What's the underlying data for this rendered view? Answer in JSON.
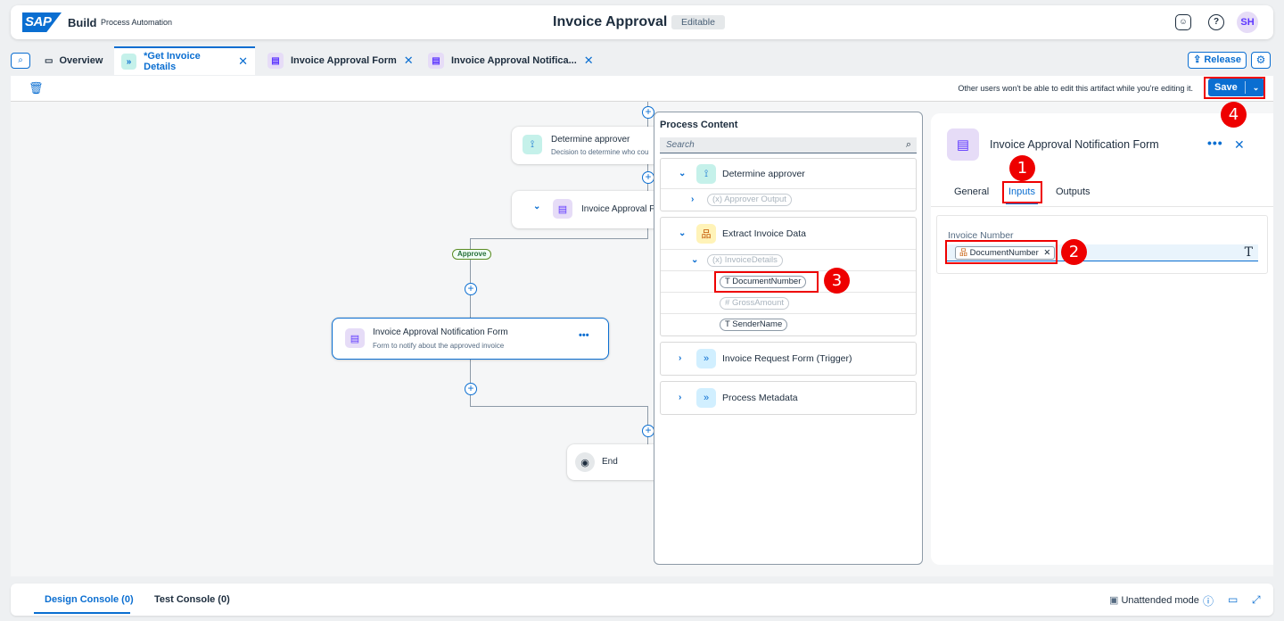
{
  "shell": {
    "logo": "SAP",
    "product": "Build",
    "subtitle": "Process Automation",
    "title": "Invoice Approval",
    "status_badge": "Editable",
    "avatar_initials": "SH"
  },
  "tabs": [
    {
      "label": "Overview"
    },
    {
      "label": "*Get Invoice Details"
    },
    {
      "label": "Invoice Approval Form"
    },
    {
      "label": "Invoice Approval Notifica..."
    }
  ],
  "actions": {
    "release": "Release",
    "save": "Save",
    "lock_note": "Other users won't be able to edit this artifact while you're editing it."
  },
  "canvas": {
    "determine_title": "Determine approver",
    "determine_sub": "Decision to determine who cou",
    "approval_form_title": "Invoice Approval Fo",
    "approve_label": "Approve",
    "notification_title": "Invoice Approval Notification Form",
    "notification_sub": "Form to notify about the approved invoice",
    "notification_menu": "•••",
    "end_label": "End"
  },
  "process_content": {
    "title": "Process Content",
    "search_placeholder": "Search",
    "groups": [
      {
        "label": "Determine approver",
        "children": [
          "Approver Output"
        ]
      },
      {
        "label": "Extract Invoice Data",
        "sub": "InvoiceDetails",
        "fields": [
          "DocumentNumber",
          "GrossAmount",
          "SenderName"
        ]
      },
      {
        "label": "Invoice Request Form (Trigger)"
      },
      {
        "label": "Process Metadata"
      }
    ]
  },
  "details": {
    "title": "Invoice Approval Notification Form",
    "tabs": [
      "General",
      "Inputs",
      "Outputs"
    ],
    "active_tab": "Inputs",
    "field_label": "Invoice Number",
    "token": "DocumentNumber"
  },
  "annotations": [
    "1",
    "2",
    "3",
    "4"
  ],
  "footer": {
    "design_console": "Design Console (0)",
    "test_console": "Test Console (0)",
    "unattended": "Unattended mode"
  },
  "colors": {
    "accent": "#0a6ed1",
    "highlight": "#ee0000"
  }
}
